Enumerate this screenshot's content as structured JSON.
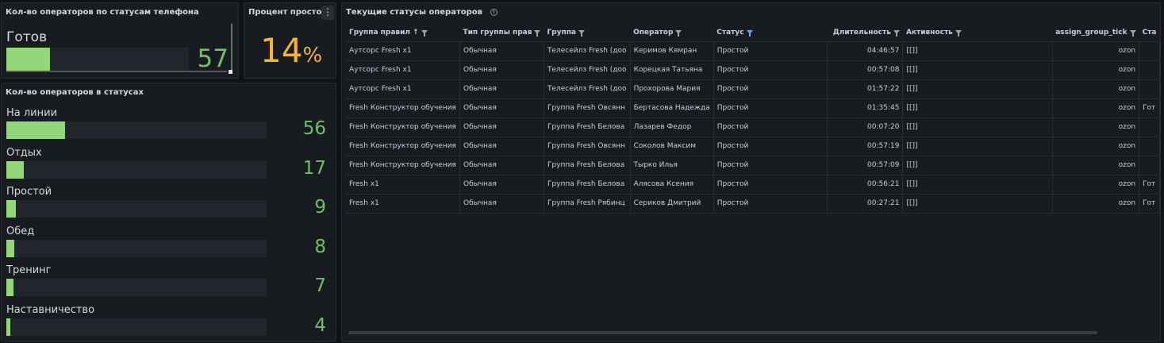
{
  "phone_panel": {
    "title": "Кол-во операторов по статусам телефона",
    "label": "Готов",
    "value": "57",
    "fraction": 0.24
  },
  "idle_panel": {
    "title": "Процент простоя",
    "value": "14",
    "unit": "%",
    "menu_icon": "more-vertical-icon"
  },
  "status_panel": {
    "title": "Кол-во операторов в статусах",
    "rows": [
      {
        "label": "На линии",
        "value": "56",
        "fraction": 0.225
      },
      {
        "label": "Отдых",
        "value": "17",
        "fraction": 0.068
      },
      {
        "label": "Простой",
        "value": "9",
        "fraction": 0.036
      },
      {
        "label": "Обед",
        "value": "8",
        "fraction": 0.032
      },
      {
        "label": "Тренинг",
        "value": "7",
        "fraction": 0.028
      },
      {
        "label": "Наставничество",
        "value": "4",
        "fraction": 0.016
      }
    ]
  },
  "table_panel": {
    "title": "Текущие статусы операторов",
    "columns": [
      {
        "label": "Группа правил",
        "sort": "↑",
        "filter": "normal"
      },
      {
        "label": "Тип группы прав",
        "filter": "normal"
      },
      {
        "label": "Группа",
        "filter": "normal"
      },
      {
        "label": "Оператор",
        "filter": "normal"
      },
      {
        "label": "Статус",
        "filter": "active"
      },
      {
        "label": "Длительность",
        "filter": "normal",
        "align": "right"
      },
      {
        "label": "Активность",
        "filter": "normal"
      },
      {
        "label": "assign_group_tick",
        "filter": "normal",
        "align": "right"
      },
      {
        "label": "Ста",
        "filter": "none"
      }
    ],
    "rows": [
      [
        "Аутсорс Fresh x1",
        "Обычная",
        "Телесейлз Fresh (доо",
        "Керимов Кямран",
        "Простой",
        "04:46:57",
        "[[]]",
        "ozon",
        ""
      ],
      [
        "Аутсорс Fresh x1",
        "Обычная",
        "Телесейлз Fresh (доо",
        "Корецкая Татьяна",
        "Простой",
        "00:57:08",
        "[[]]",
        "ozon",
        ""
      ],
      [
        "Аутсорс Fresh x1",
        "Обычная",
        "Телесейлз Fresh (доо",
        "Прохорова Мария",
        "Простой",
        "01:57:22",
        "[[]]",
        "ozon",
        ""
      ],
      [
        "Fresh Конструктор обучения",
        "Обычная",
        "Группа Fresh Овсянн",
        "Бертасова Надежда",
        "Простой",
        "01:35:45",
        "[[]]",
        "ozon",
        "Гот"
      ],
      [
        "Fresh Конструктор обучения",
        "Обычная",
        "Группа Fresh Белова",
        "Лазарев Федор",
        "Простой",
        "00:07:20",
        "[[]]",
        "ozon",
        ""
      ],
      [
        "Fresh Конструктор обучения",
        "Обычная",
        "Группа Fresh Овсянн",
        "Соколов Максим",
        "Простой",
        "00:57:19",
        "[[]]",
        "ozon",
        ""
      ],
      [
        "Fresh Конструктор обучения",
        "Обычная",
        "Группа Fresh Белова",
        "Тырко Илья",
        "Простой",
        "00:57:09",
        "[[]]",
        "ozon",
        ""
      ],
      [
        "Fresh x1",
        "Обычная",
        "Группа Fresh Белова",
        "Алясова Ксения",
        "Простой",
        "00:56:21",
        "[[]]",
        "ozon",
        "Гот"
      ],
      [
        "Fresh x1",
        "Обычная",
        "Группа Fresh Рябинц",
        "Сериков Дмитрий",
        "Простой",
        "00:27:21",
        "[[]]",
        "ozon",
        "Гот"
      ]
    ]
  },
  "colors": {
    "background": "#111217",
    "panel": "#181b1f",
    "bar_fill": "#93d67a",
    "value_green": "#73bf69",
    "stat_orange": "#f2b33c",
    "filter_active": "#6e9fff"
  }
}
